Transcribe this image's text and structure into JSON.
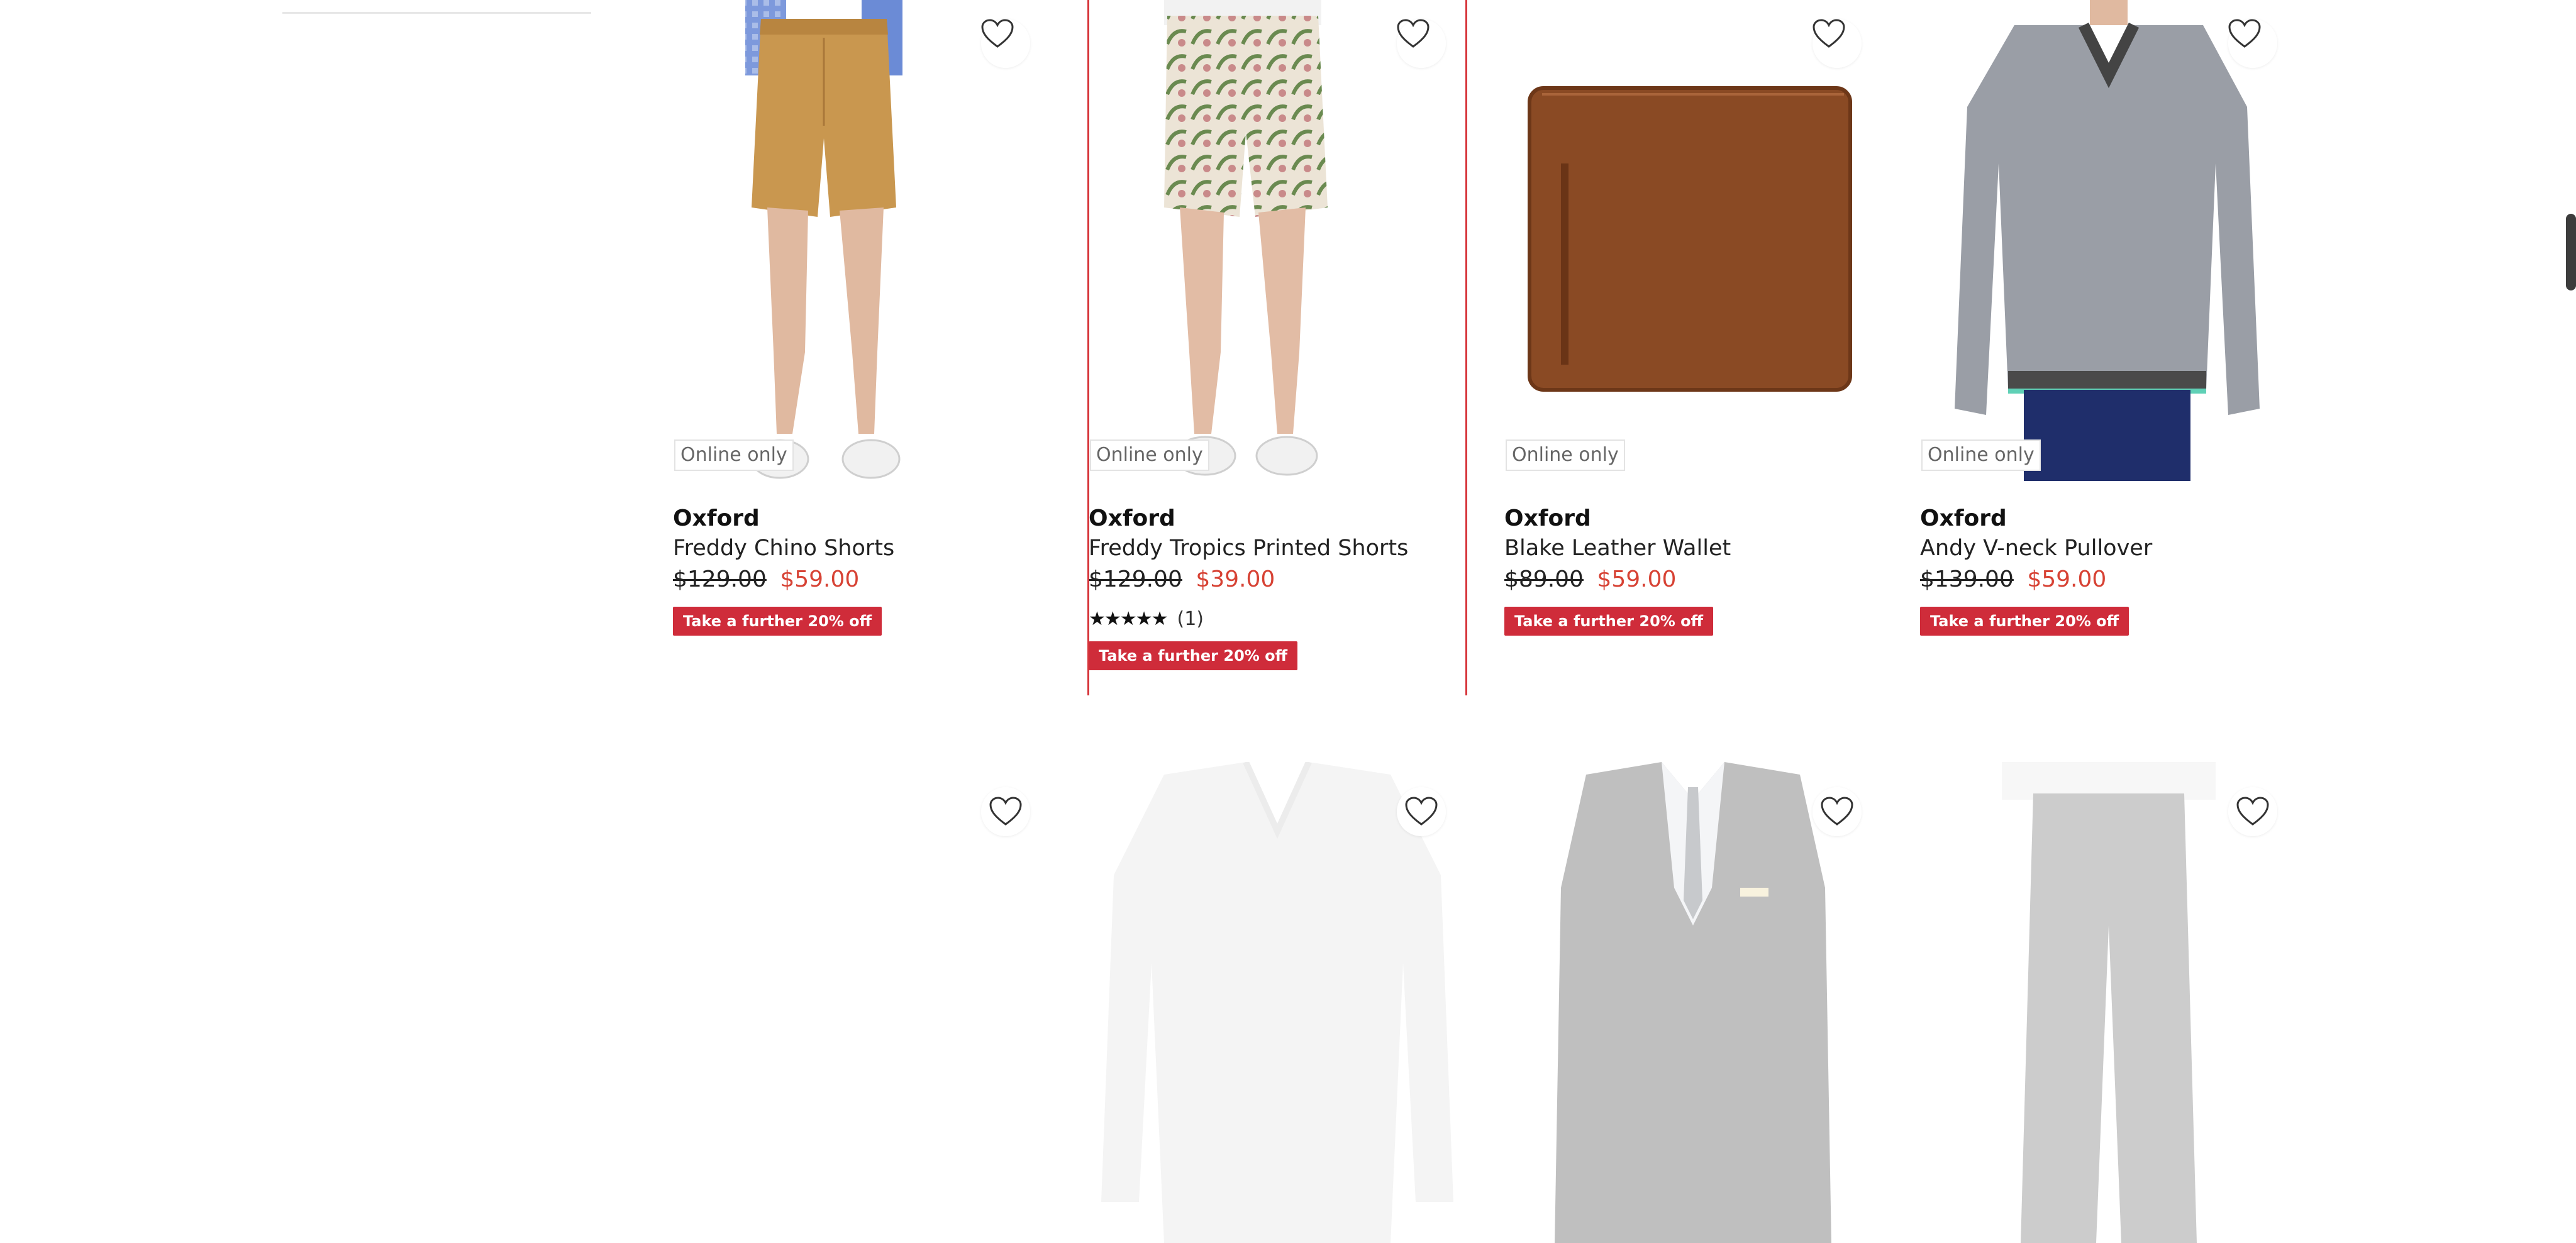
{
  "products": [
    {
      "badge": "Online only",
      "brand": "Oxford",
      "name": "Freddy Chino Shorts",
      "price_was": "$129.00",
      "price_now": "$59.00",
      "promo": "Take a further 20% off"
    },
    {
      "badge": "Online only",
      "brand": "Oxford",
      "name": "Freddy Tropics Printed Shorts",
      "price_was": "$129.00",
      "price_now": "$39.00",
      "rating_stars": "★★★★★",
      "rating_count": "(1)",
      "promo": "Take a further 20% off"
    },
    {
      "badge": "Online only",
      "brand": "Oxford",
      "name": "Blake Leather Wallet",
      "price_was": "$89.00",
      "price_now": "$59.00",
      "promo": "Take a further 20% off"
    },
    {
      "badge": "Online only",
      "brand": "Oxford",
      "name": "Andy V-neck Pullover",
      "price_was": "$139.00",
      "price_now": "$59.00",
      "promo": "Take a further 20% off"
    }
  ],
  "icons": {
    "favorite": "heart-outline-icon"
  },
  "colors": {
    "sale_price": "#d74234",
    "promo_bg": "#cf2c3a",
    "hover_border": "#d6343a"
  }
}
